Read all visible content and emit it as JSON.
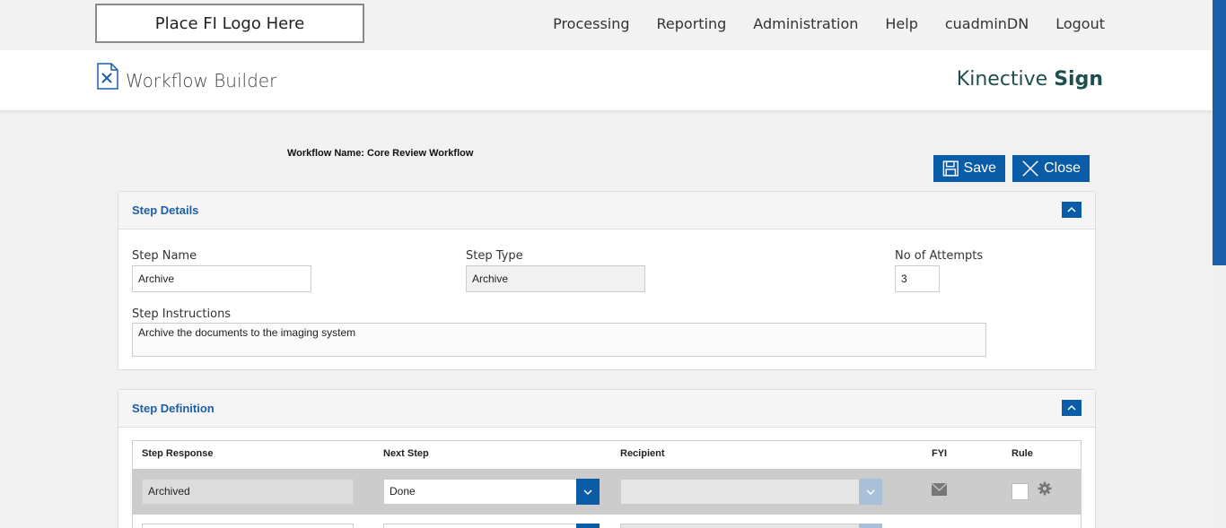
{
  "logo": "Place FI Logo Here",
  "nav": [
    "Processing",
    "Reporting",
    "Administration",
    "Help",
    "cuadminDN",
    "Logout"
  ],
  "header": {
    "title": "Workflow Builder",
    "brand_light": "Kinective ",
    "brand_bold": "Sign"
  },
  "workflow_name": "Workflow Name: Core Review Workflow",
  "buttons": {
    "save": "Save",
    "close": "Close"
  },
  "step_details": {
    "title": "Step Details",
    "step_name_label": "Step Name",
    "step_name": "Archive",
    "step_type_label": "Step Type",
    "step_type": "Archive",
    "attempts_label": "No of Attempts",
    "attempts": "3",
    "instructions_label": "Step Instructions",
    "instructions": "Archive the documents to the imaging system"
  },
  "step_definition": {
    "title": "Step Definition",
    "columns": [
      "Step Response",
      "Next Step",
      "Recipient",
      "FYI",
      "Rule"
    ],
    "rows": [
      {
        "response": "Archived",
        "next_step": "Done",
        "recipient": ""
      }
    ]
  },
  "colors": {
    "accent": "#0a5ca6",
    "brand": "#1f4e4e"
  }
}
